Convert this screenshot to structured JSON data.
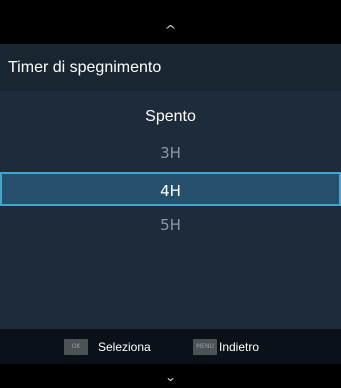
{
  "nav": {
    "up_glyph": "^",
    "down_glyph": "⌄",
    "up_icon": "chevron-up-icon",
    "down_icon": "chevron-down-icon"
  },
  "header": {
    "title": "Timer di spegnimento"
  },
  "options": [
    {
      "label": "Spento",
      "state": "current"
    },
    {
      "label": "3H",
      "state": "normal"
    },
    {
      "label": "4H",
      "state": "selected"
    },
    {
      "label": "5H",
      "state": "normal"
    }
  ],
  "footer": {
    "ok_key": "OK",
    "ok_label": "Seleziona",
    "menu_key": "MENU",
    "menu_label": "Indietro"
  },
  "colors": {
    "background": "#000000",
    "panel": "#1d2b3a",
    "header": "#192632",
    "selected_fill": "#24506e",
    "selected_border": "#3fa6cf",
    "key_fill": "#4d5257"
  }
}
